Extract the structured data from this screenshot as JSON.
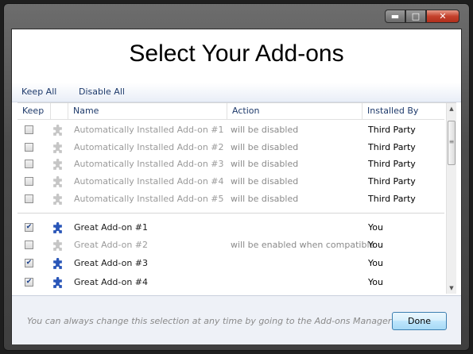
{
  "window": {
    "caption_buttons": {
      "minimize": "▬",
      "maximize": "□",
      "close": "✕"
    }
  },
  "title": "Select Your Add-ons",
  "toolbar": {
    "keep_all": "Keep All",
    "disable_all": "Disable All"
  },
  "columns": {
    "keep": "Keep",
    "name": "Name",
    "action": "Action",
    "installed_by": "Installed By"
  },
  "rows": [
    {
      "checked": false,
      "icon": "puzzle-piece-icon",
      "icon_color": "#c6c6c6",
      "name": "Automatically Installed Add-on #1",
      "action": "will be disabled",
      "installed_by": "Third Party"
    },
    {
      "checked": false,
      "icon": "puzzle-piece-icon",
      "icon_color": "#c6c6c6",
      "name": "Automatically Installed Add-on #2",
      "action": "will be disabled",
      "installed_by": "Third Party"
    },
    {
      "checked": false,
      "icon": "puzzle-piece-icon",
      "icon_color": "#c6c6c6",
      "name": "Automatically Installed Add-on #3",
      "action": "will be disabled",
      "installed_by": "Third Party"
    },
    {
      "checked": false,
      "icon": "puzzle-piece-icon",
      "icon_color": "#c6c6c6",
      "name": "Automatically Installed Add-on #4",
      "action": "will be disabled",
      "installed_by": "Third Party"
    },
    {
      "checked": false,
      "icon": "puzzle-piece-icon",
      "icon_color": "#c6c6c6",
      "name": "Automatically Installed Add-on #5",
      "action": "will be disabled",
      "installed_by": "Third Party"
    },
    {
      "checked": true,
      "icon": "puzzle-piece-icon",
      "icon_color": "#2a56b8",
      "name": "Great Add-on #1",
      "action": "",
      "installed_by": "You"
    },
    {
      "checked": false,
      "icon": "puzzle-piece-icon",
      "icon_color": "#c6c6c6",
      "name": "Great Add-on #2",
      "action": "will be enabled when compatible",
      "installed_by": "You"
    },
    {
      "checked": true,
      "icon": "puzzle-piece-icon",
      "icon_color": "#2a56b8",
      "name": "Great Add-on #3",
      "action": "",
      "installed_by": "You"
    },
    {
      "checked": true,
      "icon": "puzzle-piece-icon",
      "icon_color": "#2a56b8",
      "name": "Great Add-on #4",
      "action": "",
      "installed_by": "You"
    }
  ],
  "checkmark": "✔",
  "scrollbar": {
    "up": "▲",
    "down": "▼",
    "grip": "≡"
  },
  "footer": {
    "note": "You can always change this selection at any time by going to the Add-ons Manager",
    "done_label": "Done"
  }
}
